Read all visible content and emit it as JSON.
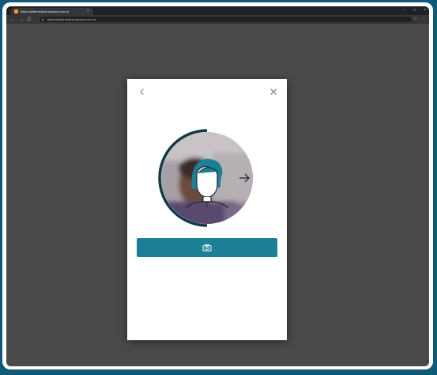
{
  "browser": {
    "tab_title": "https://sellercentral.amazon.com.tr",
    "tab_close": "×",
    "url": "https://sellercentral.amazon.com.tr",
    "window_controls": [
      "–",
      "□",
      "×"
    ],
    "nav": {
      "back": "←",
      "forward": "→",
      "reload": "C"
    },
    "toolbar_icons": [
      "star-icon",
      "menu-dots-icon"
    ]
  },
  "modal": {
    "back_icon": "chevron-left-icon",
    "close_icon": "close-icon",
    "face_guide_icon": "face-outline-icon",
    "turn_direction_icon": "arrow-right-icon",
    "capture_button_icon": "camera-icon",
    "accent_color": "#1b7f96"
  }
}
